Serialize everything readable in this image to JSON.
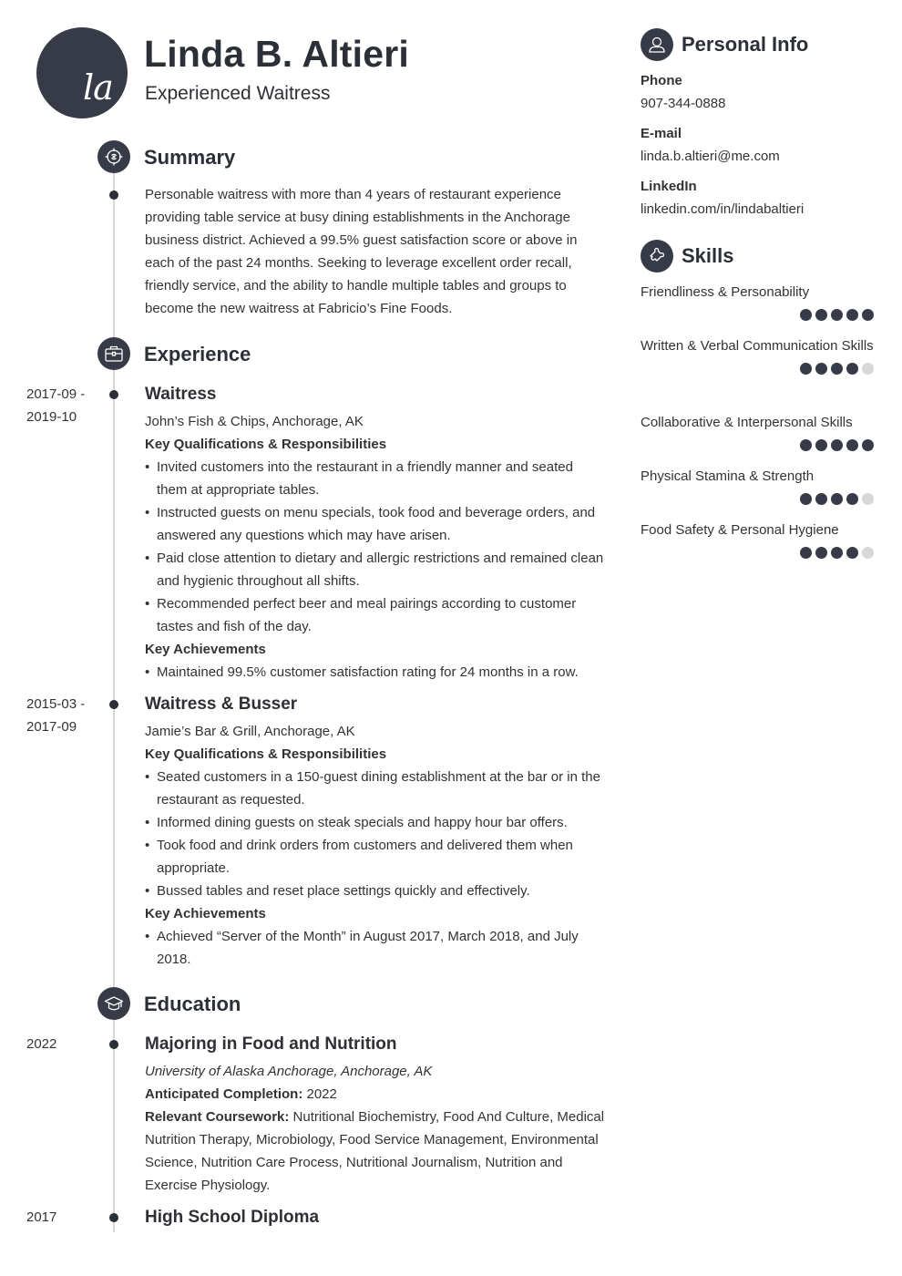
{
  "header": {
    "monogram": "la",
    "name": "Linda B. Altieri",
    "title": "Experienced Waitress"
  },
  "summary": {
    "heading": "Summary",
    "icon": "target-icon",
    "text": "Personable waitress with more than 4 years of restaurant experience providing table service at busy dining establishments in the Anchorage business district. Achieved a 99.5% guest satisfaction score or above in each of the past 24 months. Seeking to leverage excellent order recall, friendly service, and the ability to handle multiple tables and groups to become the new waitress at Fabricio’s Fine Foods."
  },
  "experience": {
    "heading": "Experience",
    "icon": "briefcase-icon",
    "jobs": [
      {
        "date_start": "2017-09 -",
        "date_end": "2019-10",
        "title": "Waitress",
        "employer": "John’s Fish & Chips, Anchorage, AK",
        "qual_heading": "Key Qualifications & Responsibilities",
        "responsibilities": [
          "Invited customers into the restaurant in a friendly manner and seated them at appropriate tables.",
          "Instructed guests on menu specials, took food and beverage orders, and answered any questions which may have arisen.",
          "Paid close attention to dietary and allergic restrictions and remained clean and hygienic throughout all shifts.",
          "Recommended perfect beer and meal pairings according to customer tastes and fish of the day."
        ],
        "ach_heading": "Key Achievements",
        "achievements": [
          "Maintained 99.5% customer satisfaction rating for 24 months in a row."
        ]
      },
      {
        "date_start": "2015-03 -",
        "date_end": "2017-09",
        "title": "Waitress & Busser",
        "employer": "Jamie’s Bar & Grill, Anchorage, AK",
        "qual_heading": "Key Qualifications & Responsibilities",
        "responsibilities": [
          "Seated customers in a 150-guest dining establishment at the bar or in the restaurant as requested.",
          "Informed dining guests on steak specials and happy hour bar offers.",
          "Took food and drink orders from customers and delivered them when appropriate.",
          "Bussed tables and reset place settings quickly and effectively."
        ],
        "ach_heading": "Key Achievements",
        "achievements": [
          "Achieved “Server of the Month” in August 2017, March 2018, and July 2018."
        ]
      }
    ]
  },
  "education": {
    "heading": "Education",
    "icon": "graduation-cap-icon",
    "items": [
      {
        "date": "2022",
        "degree": "Majoring in Food and Nutrition",
        "school": "University of Alaska Anchorage, Anchorage, AK",
        "completion_label": "Anticipated Completion:",
        "completion_value": " 2022",
        "coursework_label": "Relevant Coursework:",
        "coursework_value": " Nutritional Biochemistry, Food And Culture, Medical Nutrition Therapy, Microbiology, Food Service Management, Environmental Science, Nutrition Care Process, Nutritional Journalism, Nutrition and Exercise Physiology."
      },
      {
        "date": "2017",
        "degree": "High School Diploma"
      }
    ]
  },
  "personal_info": {
    "heading": "Personal Info",
    "icon": "person-icon",
    "phone_label": "Phone",
    "phone": "907-344-0888",
    "email_label": "E-mail",
    "email": "linda.b.altieri@me.com",
    "linkedin_label": "LinkedIn",
    "linkedin": "linkedin.com/in/lindabaltieri"
  },
  "skills": {
    "heading": "Skills",
    "icon": "puzzle-icon",
    "max_rating": 5,
    "items": [
      {
        "name": "Friendliness & Personability",
        "rating": 5
      },
      {
        "name": "Written & Verbal Communication Skills",
        "rating": 4
      },
      {
        "name": "Collaborative & Interpersonal Skills",
        "rating": 5
      },
      {
        "name": "Physical Stamina & Strength",
        "rating": 4
      },
      {
        "name": "Food Safety & Personal Hygiene",
        "rating": 4
      }
    ]
  },
  "colors": {
    "accent": "#363b47",
    "rating_off": "#d8d8d8",
    "timeline": "#d6d6d6"
  }
}
